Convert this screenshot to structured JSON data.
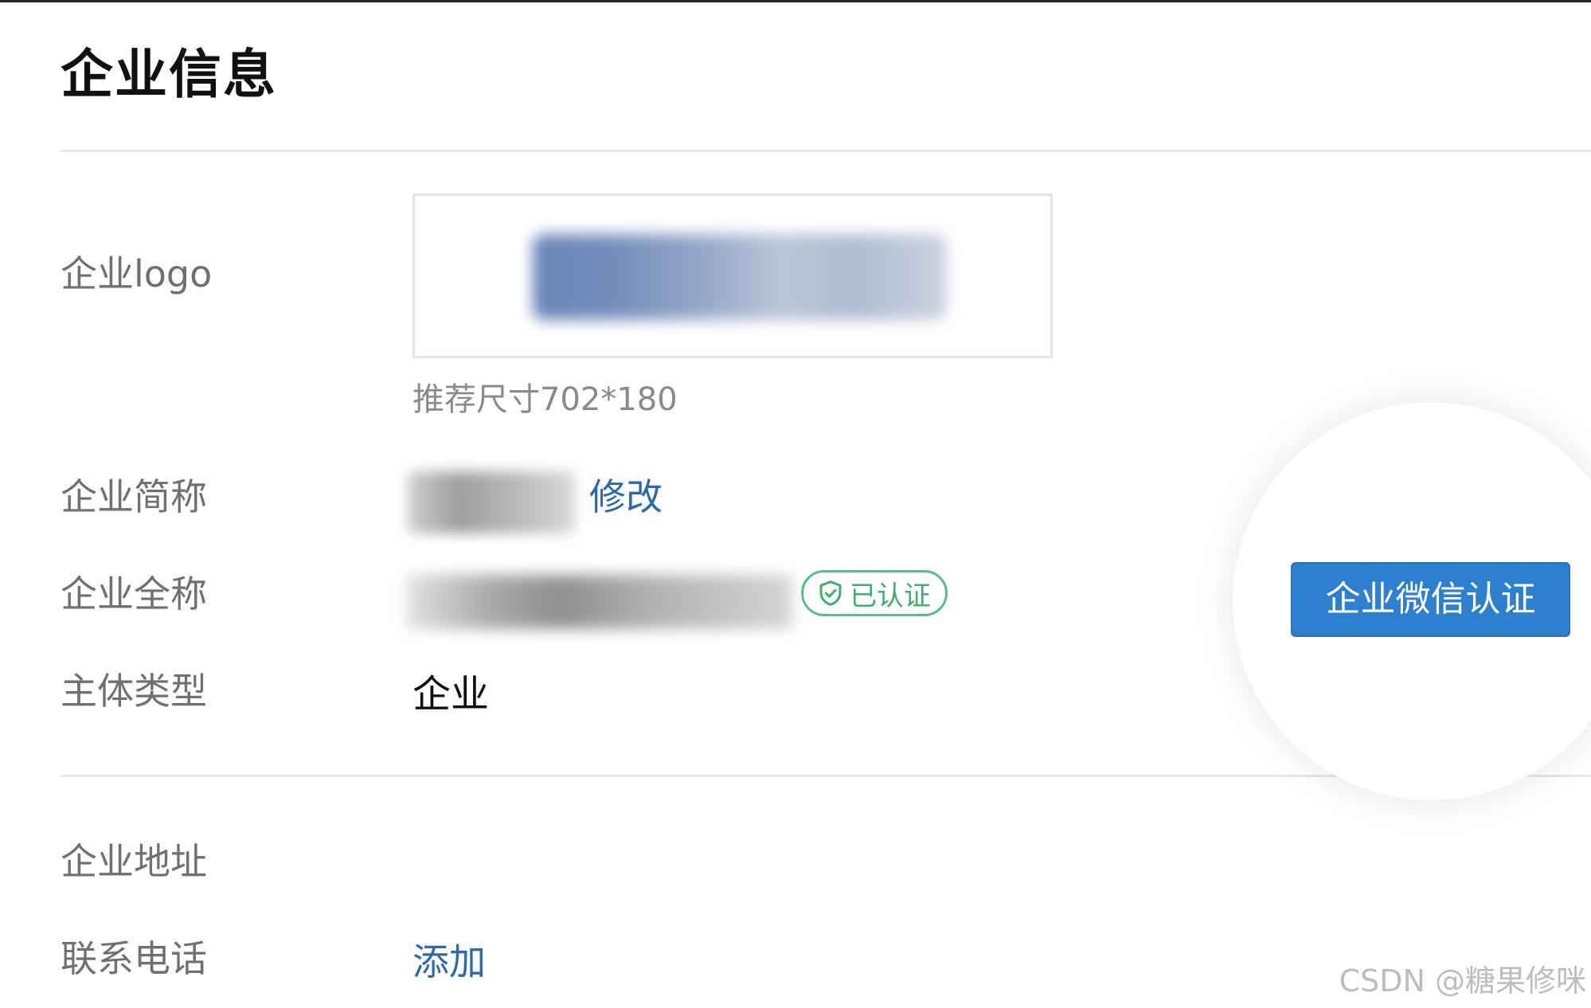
{
  "page": {
    "title": "企业信息"
  },
  "fields": {
    "logo": {
      "label": "企业logo",
      "hint": "推荐尺寸702*180"
    },
    "short_name": {
      "label": "企业简称",
      "edit_label": "修改"
    },
    "full_name": {
      "label": "企业全称",
      "badge": "已认证"
    },
    "entity_type": {
      "label": "主体类型",
      "value": "企业"
    },
    "address": {
      "label": "企业地址"
    },
    "phone": {
      "label": "联系电话",
      "add_label": "添加"
    }
  },
  "actions": {
    "wework_cert_label": "企业微信认证"
  },
  "watermark": "CSDN @糖果修咪",
  "colors": {
    "link": "#2f6aa8",
    "primary_button": "#2d7fcf",
    "verified_green": "#54c083"
  },
  "icons": {
    "verified": "shield-check-icon"
  }
}
